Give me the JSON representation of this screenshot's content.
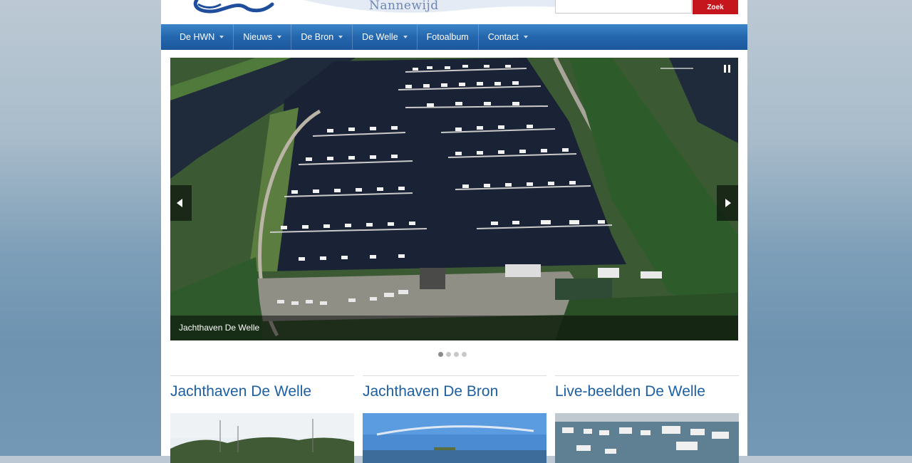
{
  "header": {
    "brand": "Nannewijd",
    "search_placeholder": "",
    "search_button": "Zoek"
  },
  "nav": {
    "items": [
      {
        "label": "De HWN",
        "has_dropdown": true
      },
      {
        "label": "Nieuws",
        "has_dropdown": true
      },
      {
        "label": "De Bron",
        "has_dropdown": true
      },
      {
        "label": "De Welle",
        "has_dropdown": true
      },
      {
        "label": "Fotoalbum",
        "has_dropdown": false
      },
      {
        "label": "Contact",
        "has_dropdown": true
      }
    ]
  },
  "slider": {
    "caption": "Jachthaven De Welle",
    "slide_count": 4,
    "active_slide": 1,
    "image_description_icon": "aerial-marina-photo"
  },
  "columns": [
    {
      "title": "Jachthaven De Welle",
      "image": "marina-boats-photo"
    },
    {
      "title": "Jachthaven De Bron",
      "image": "lake-sky-photo"
    },
    {
      "title": "Live-beelden De Welle",
      "image": "webcam-marina-photo"
    }
  ],
  "colors": {
    "nav_blue": "#2466ad",
    "heading_blue": "#1d5fa3",
    "search_red": "#c4161c"
  }
}
